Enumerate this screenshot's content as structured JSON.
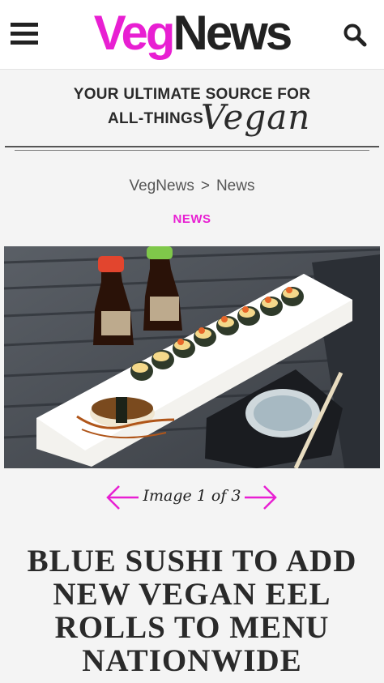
{
  "header": {
    "logo_part1": "Veg",
    "logo_part2": "News",
    "menu_icon": "hamburger-icon",
    "search_icon": "search-icon",
    "brand_color": "#e81fd2"
  },
  "tagline": {
    "line1": "YOUR ULTIMATE SOURCE FOR",
    "line2": "ALL-THINGS",
    "script_word": "Vegan"
  },
  "breadcrumb": {
    "home": "VegNews",
    "separator": ">",
    "current": "News"
  },
  "section": {
    "label": "NEWS"
  },
  "gallery": {
    "counter": "Image 1 of 3",
    "prev_icon": "arrow-left-icon",
    "next_icon": "arrow-right-icon",
    "image_alt": "Sushi rolls on a white plate with soy sauce bottles"
  },
  "article": {
    "headline": "Blue Sushi to Add New Vegan Eel Rolls to Menu Nationwide"
  }
}
